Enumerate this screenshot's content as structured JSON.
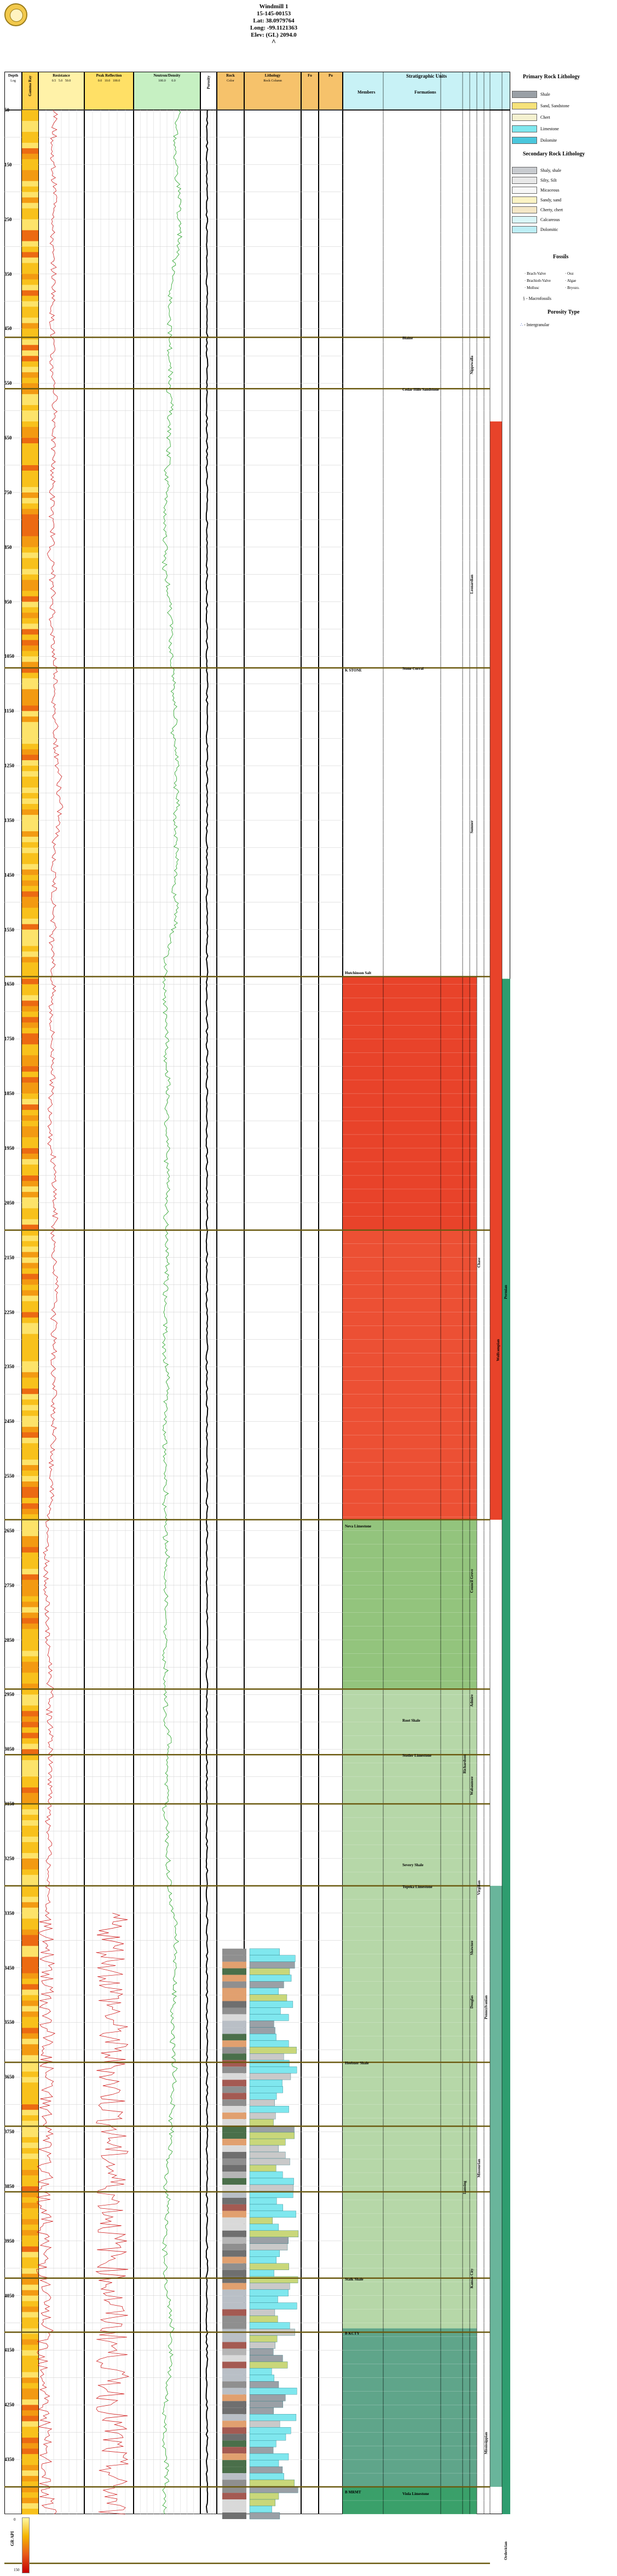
{
  "header": {
    "well_name": "Windmill 1",
    "api": "15-145-00153",
    "lat": "Lat: 38.0979764",
    "long": "Long: -99.1121363",
    "elev": "Elev: (GL) 2094.0",
    "arrow": "^"
  },
  "columns": {
    "depth": {
      "title": "Depth",
      "sub": "Log"
    },
    "gamma": {
      "title": "Gamma Ray",
      "sub": "Colour"
    },
    "resistance": {
      "title": "Resistance",
      "scale": [
        "0.5",
        "5.0",
        "50.0"
      ]
    },
    "photo": {
      "title": "Rock Physics"
    },
    "pe": {
      "title": "Peak Reflection",
      "scale": [
        "0.0",
        "10.0",
        "100.0"
      ]
    },
    "neutron": {
      "title": "Neutron/Density",
      "scale": [
        "100.0",
        "0.0"
      ]
    },
    "porosity": {
      "title": "Porosity"
    },
    "rock": {
      "title": "Rock",
      "sub": "Color"
    },
    "lithology": {
      "title": "Lithology",
      "sub": "Rock Column"
    },
    "fossils_col": {
      "title": "Fo"
    },
    "porosity_type": {
      "title": "Po"
    },
    "strat": {
      "title": "Stratigraphic Units",
      "members": "Members",
      "formations": "Formations"
    }
  },
  "depths": [
    "50",
    "150",
    "250",
    "350",
    "450",
    "550",
    "650",
    "750",
    "850",
    "950",
    "1050",
    "1150",
    "1250",
    "1350",
    "1450",
    "1550",
    "1650",
    "1750",
    "1850",
    "1950",
    "2050",
    "2150",
    "2250",
    "2350",
    "2450",
    "2550",
    "2650",
    "2750",
    "2850",
    "2950",
    "3050",
    "3150",
    "3250",
    "3350",
    "3450",
    "3550",
    "3650",
    "3750",
    "3850",
    "3950",
    "4050",
    "4150",
    "4250",
    "4350"
  ],
  "strat_labels": [
    {
      "text": "Blaine",
      "col": "formation",
      "depth": 466
    },
    {
      "text": "Cedar Hills Sandstone",
      "col": "formation",
      "depth": 560
    },
    {
      "text": "K STONE",
      "col": "member",
      "depth": 1074
    },
    {
      "text": "Stone Corral",
      "col": "formation",
      "depth": 1071
    },
    {
      "text": "Hutchinson Salt",
      "col": "member",
      "depth": 1628
    },
    {
      "text": "Neva Limestone",
      "col": "member",
      "depth": 2640
    },
    {
      "text": "Root Shale",
      "col": "formation",
      "depth": 2996
    },
    {
      "text": "Stotler Limestone",
      "col": "formation",
      "depth": 3060
    },
    {
      "text": "Severy Shale",
      "col": "formation",
      "depth": 3260
    },
    {
      "text": "Topeka Limestone",
      "col": "formation",
      "depth": 3300
    },
    {
      "text": "Heebner Shale",
      "col": "member",
      "depth": 3623
    },
    {
      "text": "Stalk Shale",
      "col": "member",
      "depth": 4018
    },
    {
      "text": "B KCTY",
      "col": "member",
      "depth": 4117
    },
    {
      "text": "B MRMT",
      "col": "member",
      "depth": 4408
    },
    {
      "text": "Viola Limestone",
      "col": "formation",
      "depth": 4411
    }
  ],
  "strat_vlabels": [
    {
      "text": "Nippewalla",
      "depth": 500
    },
    {
      "text": "Leonardian",
      "depth": 900
    },
    {
      "text": "Sumner",
      "depth": 1350
    },
    {
      "text": "Chase",
      "depth": 2150
    },
    {
      "text": "Wolfcampian",
      "depth": 2300
    },
    {
      "text": "Council Grove",
      "depth": 2720
    },
    {
      "text": "Admire",
      "depth": 2950
    },
    {
      "text": "Wabaunsee",
      "depth": 3100
    },
    {
      "text": "Richardson",
      "depth": 3060
    },
    {
      "text": "Shawnee",
      "depth": 3400
    },
    {
      "text": "Virgilian",
      "depth": 3290
    },
    {
      "text": "Douglas",
      "depth": 3500
    },
    {
      "text": "Pennsylvanian",
      "depth": 3500
    },
    {
      "text": "Lansing",
      "depth": 3840
    },
    {
      "text": "Missourian",
      "depth": 3800
    },
    {
      "text": "Kansas City",
      "depth": 4000
    },
    {
      "text": "Permian",
      "depth": 2200
    },
    {
      "text": "Mississippian",
      "depth": 4300
    },
    {
      "text": "Ordovician",
      "depth": 4500
    }
  ],
  "legend": {
    "primary_title": "Primary Rock Lithology",
    "primary": [
      {
        "label": "Shale",
        "color": "#9aa0a6"
      },
      {
        "label": "Sand, Sandstone",
        "color": "#f6e27a"
      },
      {
        "label": "Chert",
        "color": "#f4f1d0"
      },
      {
        "label": "Limestone",
        "color": "#7fe7ee"
      },
      {
        "label": "Dolomite",
        "color": "#4bc7dc"
      }
    ],
    "secondary_title": "Secondary Rock Lithology",
    "secondary": [
      {
        "label": "Shaly, shale",
        "color": "#c9ccd0"
      },
      {
        "label": "Silty, Silt",
        "color": "#e8e8e8"
      },
      {
        "label": "Micaceous",
        "color": "#f7f7f7"
      },
      {
        "label": "Sandy, sand",
        "color": "#fbf3c4"
      },
      {
        "label": "Cherty, chert",
        "color": "#f4e7c7"
      },
      {
        "label": "Calcareous",
        "color": "#d9f6f8"
      },
      {
        "label": "Dolomitic",
        "color": "#bdeef5"
      }
    ],
    "fossils_title": "Fossils",
    "fossils": [
      {
        "label": "Brach-Valve"
      },
      {
        "label": "Brachiob-Valve"
      },
      {
        "label": "Mollusc"
      },
      {
        "label": "Ooz"
      },
      {
        "label": "Algae"
      },
      {
        "label": "Bryozo."
      }
    ],
    "macro_label": "- Macrofossils",
    "porosity_title": "Porosity Type",
    "porosity": [
      {
        "label": "- Intergranular"
      }
    ]
  },
  "gr_scale": {
    "top": "GR API",
    "min": "0",
    "max": "150"
  },
  "colors": {
    "evaporite_red": "#e8432a",
    "chase_red": "#ef5a3c",
    "council_green": "#93c47d",
    "light_green": "#b6d7a8",
    "teal": "#5fa58a",
    "dark_green": "#3aa06a",
    "formation_line": "#6b5a10",
    "strat_header": "#c8f2f6",
    "rock_header": "#f6c26b",
    "resist_header": "#fff2a8",
    "pe_header": "#ffe066",
    "neutron_header": "#c6f0c2"
  }
}
